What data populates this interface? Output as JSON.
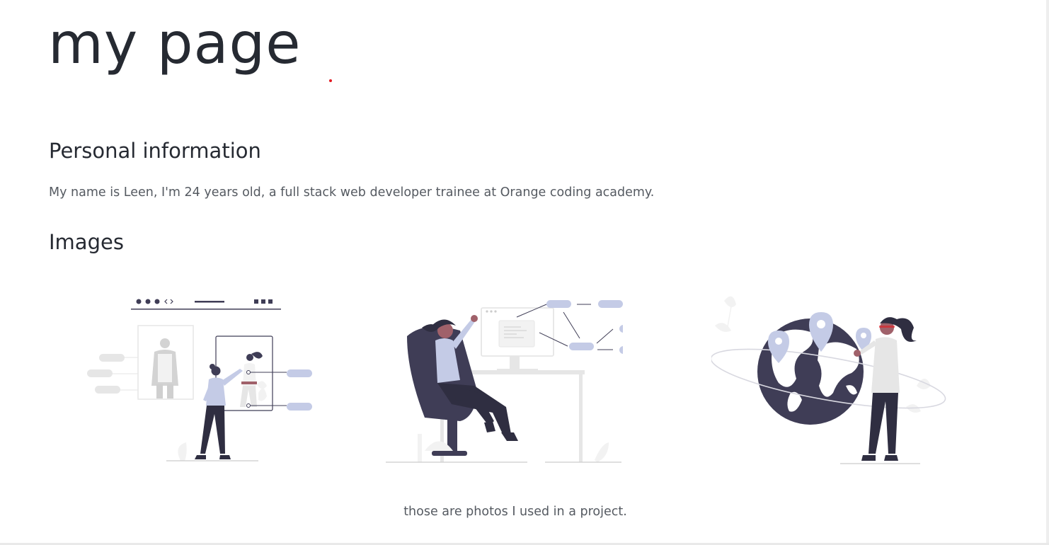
{
  "header": {
    "title": "my page"
  },
  "personal": {
    "heading": "Personal information",
    "bio": "My name is Leen, I'm 24 years old, a full stack web developer trainee at Orange coding academy."
  },
  "images": {
    "heading": "Images",
    "caption": "those are photos I used in a project.",
    "items": [
      {
        "icon": "profile-builder-illustration"
      },
      {
        "icon": "developer-chair-illustration"
      },
      {
        "icon": "world-map-illustration"
      }
    ]
  },
  "colors": {
    "text": "#262a32",
    "body_text": "#555a61",
    "accent_dot": "#e31b23",
    "illustration_dark": "#3f3d56",
    "illustration_light": "#c4cbe6",
    "illustration_gray": "#e6e6e6"
  }
}
